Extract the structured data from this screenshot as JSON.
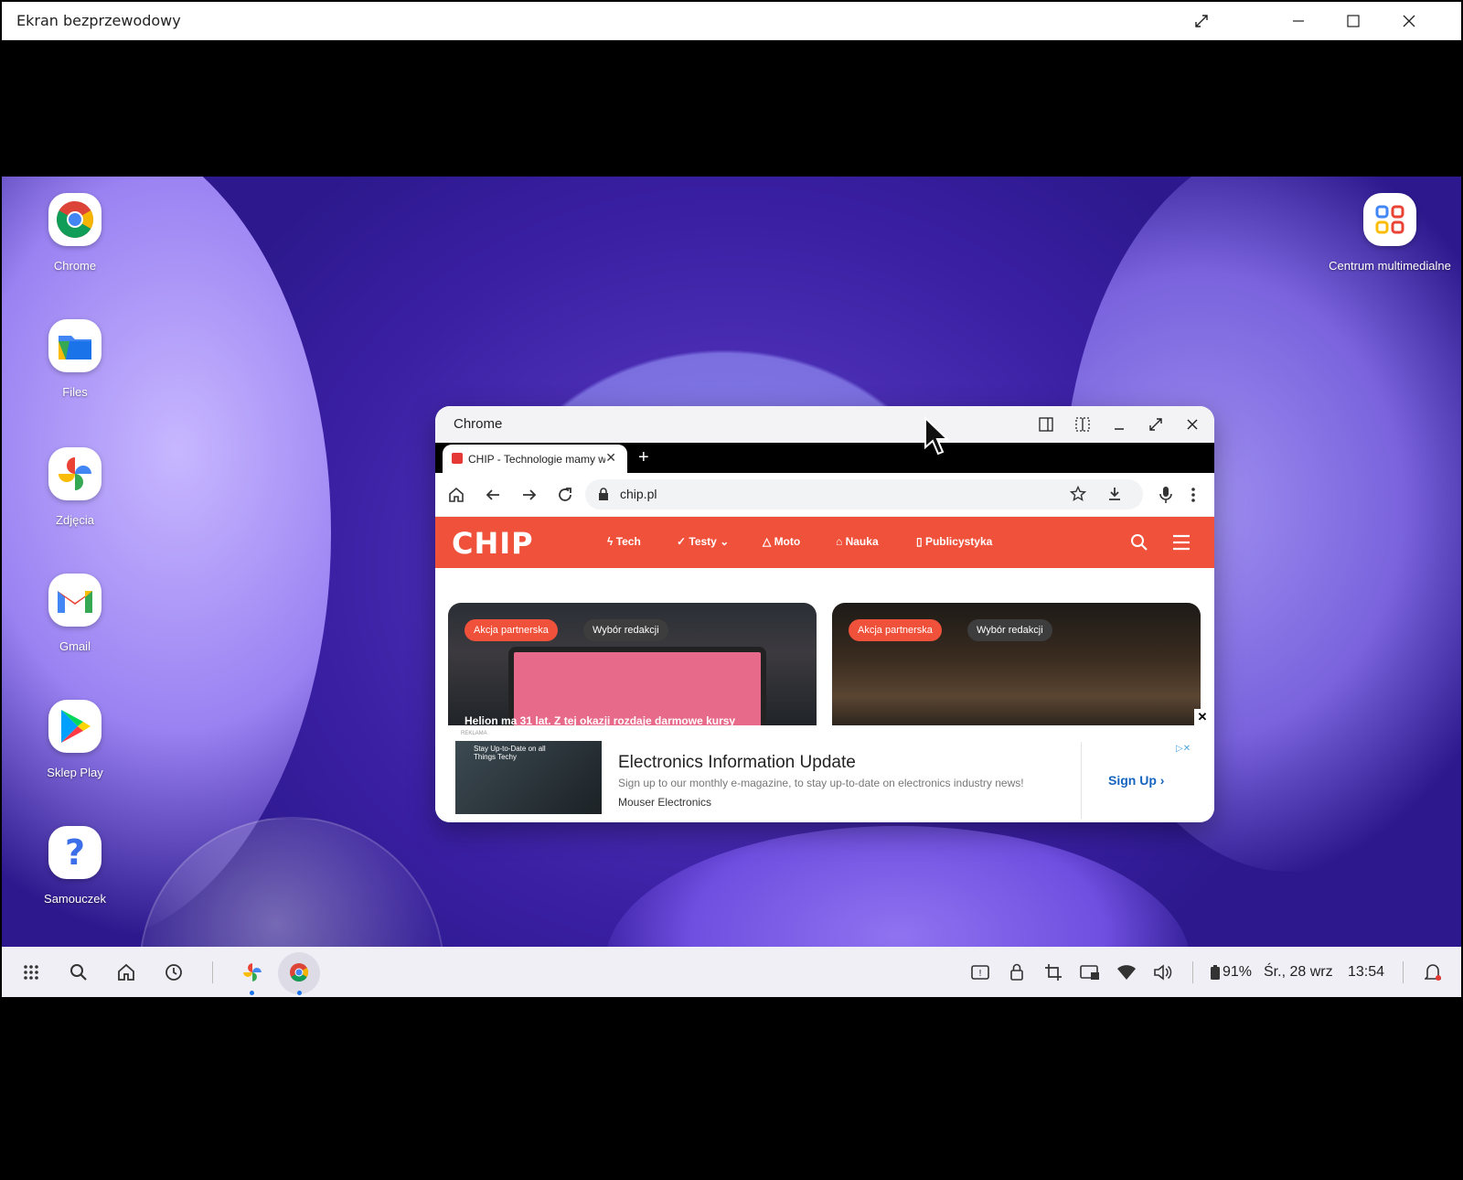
{
  "outer_window": {
    "title": "Ekran bezprzewodowy"
  },
  "desktop": {
    "icons": [
      {
        "label": "Chrome",
        "icon": "chrome-icon"
      },
      {
        "label": "Files",
        "icon": "files-icon"
      },
      {
        "label": "Zdjęcia",
        "icon": "photos-icon"
      },
      {
        "label": "Gmail",
        "icon": "gmail-icon"
      },
      {
        "label": "Sklep Play",
        "icon": "play-store-icon"
      },
      {
        "label": "Samouczek",
        "icon": "help-icon"
      }
    ],
    "right_icon": {
      "label": "Centrum multimedialne",
      "icon": "media-center-icon"
    }
  },
  "chrome_window": {
    "title": "Chrome",
    "tab_title": "CHIP - Technologie mamy w",
    "url": "chip.pl"
  },
  "site": {
    "logo": "CHIP",
    "nav": [
      "Tech",
      "Testy",
      "Moto",
      "Nauka",
      "Publicystyka"
    ],
    "cards": [
      {
        "badges": [
          "Akcja partnerska",
          "Wybór redakcji"
        ],
        "headline": "Helion ma 31 lat. Z tej okazji rozdaje darmowe kursy"
      },
      {
        "badges": [
          "Akcja partnerska",
          "Wybór redakcji"
        ],
        "headline": ""
      }
    ],
    "ad": {
      "tag": "REKLAMA",
      "image_text": "Stay Up-to-Date on all Things Techy",
      "headline": "Electronics Information Update",
      "description": "Sign up to our monthly e-magazine, to stay up-to-date on electronics industry news!",
      "sponsor": "Mouser Electronics",
      "cta": "Sign Up"
    }
  },
  "taskbar": {
    "battery": "91%",
    "date": "Śr., 28 wrz",
    "time": "13:54"
  },
  "colors": {
    "chip_red": "#f0513a",
    "accent_blue": "#1565c0"
  }
}
